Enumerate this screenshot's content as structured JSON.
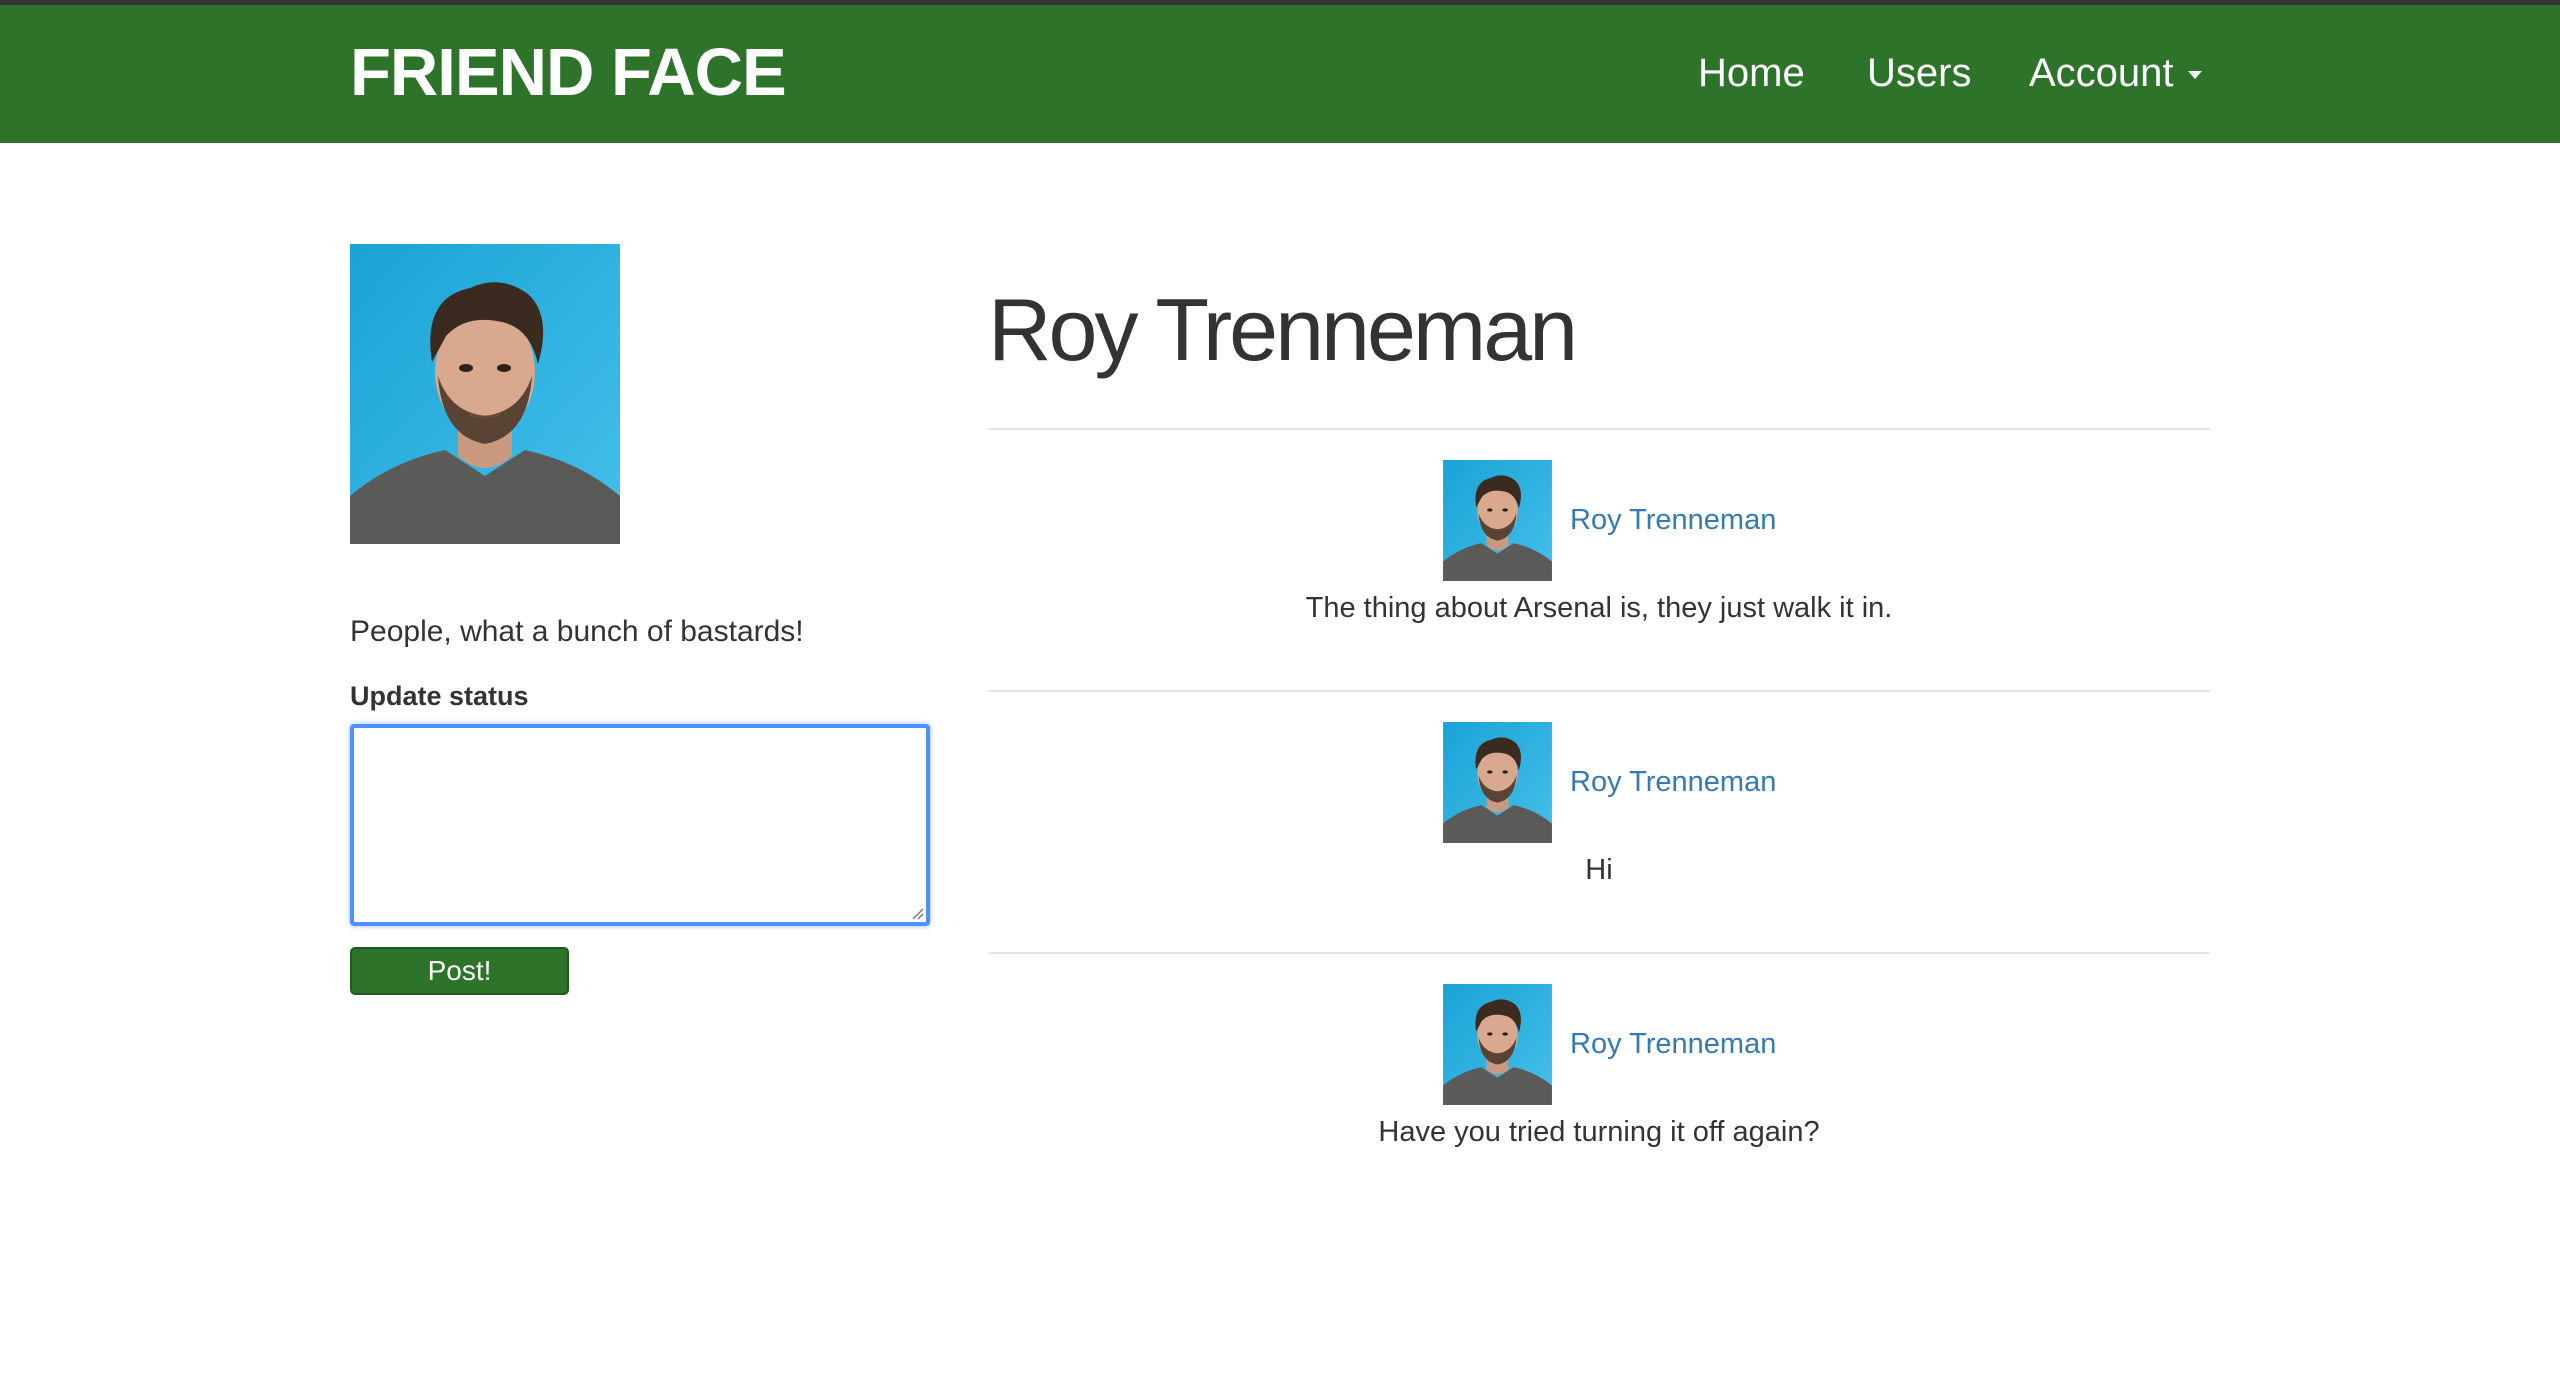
{
  "navbar": {
    "brand": "FRIEND FACE",
    "links": {
      "home": "Home",
      "users": "Users",
      "account": "Account"
    },
    "color": "#2d7329"
  },
  "profile": {
    "name": "Roy Trenneman",
    "status": "People, what a bunch of bastards!",
    "update_label": "Update status",
    "status_input_value": "",
    "post_button": "Post!"
  },
  "feed": [
    {
      "author": "Roy Trenneman",
      "body": "The thing about Arsenal is, they just walk it in."
    },
    {
      "author": "Roy Trenneman",
      "body": "Hi"
    },
    {
      "author": "Roy Trenneman",
      "body": "Have you tried turning it off again?"
    }
  ],
  "colors": {
    "link": "#337ab7",
    "focus": "#4d90fe"
  }
}
